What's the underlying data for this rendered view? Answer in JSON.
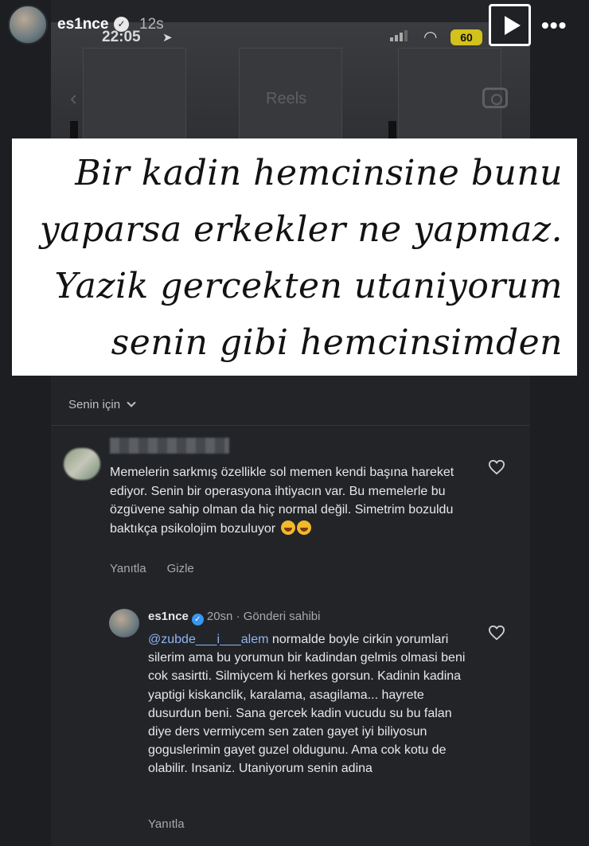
{
  "story_header": {
    "username": "es1nce",
    "posted_ago": "12s",
    "clock": "22:05",
    "battery": "60"
  },
  "background_screen": {
    "title": "Reels"
  },
  "quote": {
    "lines": [
      "Bir kadin hemcinsine bunu",
      "yaparsa erkekler ne yapmaz.",
      "Yazik gercekten utaniyorum",
      "senin gibi hemcinsimden"
    ]
  },
  "comments_panel": {
    "filter_label": "Senin için",
    "comment1": {
      "text": "Memelerin sarkmış özellikle sol memen kendi başına hareket ediyor. Senin bir operasyona ihtiyacın var. Bu memelerle bu özgüvene sahip olman da hiç normal değil. Simetrim bozuldu baktıkça psikolojim bozuluyor",
      "reply_label": "Yanıtla",
      "hide_label": "Gizle"
    },
    "comment2": {
      "username": "es1nce",
      "time": "20sn",
      "separator": "·",
      "role": "Gönderi sahibi",
      "mention": "@zubde___i___alem",
      "text": " normalde boyle cirkin yorumlari silerim ama bu yorumun bir kadindan gelmis olmasi beni cok sasirtti. Silmiycem ki herkes gorsun. Kadinin kadina yaptigi kiskanclik, karalama, asagilama... hayrete dusurdun beni. Sana gercek kadin vucudu su bu falan diye ders vermiycem sen zaten gayet iyi biliyosun goguslerimin gayet guzel oldugunu. Ama cok kotu de olabilir. Insaniz. Utaniyorum senin adina",
      "reply_label": "Yanıtla"
    }
  }
}
